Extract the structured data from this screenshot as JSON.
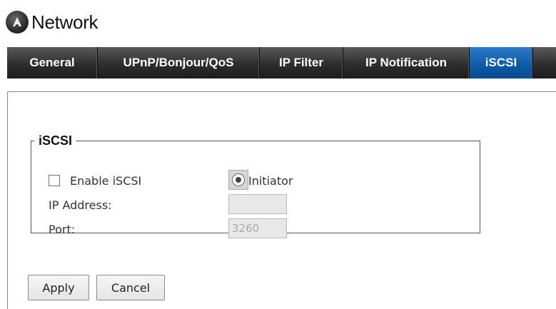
{
  "header": {
    "title": "Network",
    "icon": "network-logo-icon"
  },
  "tabs": [
    {
      "label": "General",
      "active": false
    },
    {
      "label": "UPnP/Bonjour/QoS",
      "active": false
    },
    {
      "label": "IP Filter",
      "active": false
    },
    {
      "label": "IP Notification",
      "active": false
    },
    {
      "label": "iSCSI",
      "active": true
    }
  ],
  "iscsi_group": {
    "legend": "iSCSI",
    "enable_label": "Enable iSCSI",
    "enable_checked": false,
    "initiator_label": "Initiator",
    "initiator_selected": true,
    "ip_address_label": "IP Address:",
    "ip_address_value": "",
    "port_label": "Port:",
    "port_value": "3260"
  },
  "actions": {
    "apply_label": "Apply",
    "cancel_label": "Cancel"
  },
  "colors": {
    "tab_bar": "#2e2e2e",
    "active_tab": "#0b5aa8",
    "panel_border": "#8a8a8a"
  }
}
